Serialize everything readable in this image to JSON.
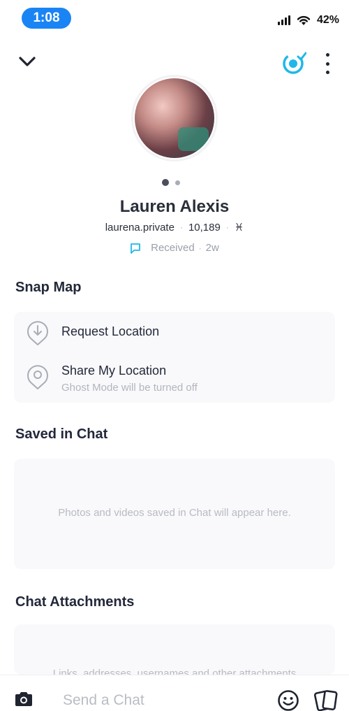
{
  "status_bar": {
    "time": "1:08",
    "battery": "42%"
  },
  "profile": {
    "name": "Lauren Alexis",
    "username": "laurena.private",
    "score": "10,189",
    "zodiac": "♓",
    "chat_status": "Received",
    "chat_age": "2w"
  },
  "snap_map": {
    "title": "Snap Map",
    "request_location": "Request Location",
    "share_location": "Share My Location",
    "share_location_sub": "Ghost Mode will be turned off"
  },
  "saved_in_chat": {
    "title": "Saved in Chat",
    "empty_text": "Photos and videos saved in Chat will appear here."
  },
  "chat_attachments": {
    "title": "Chat Attachments",
    "empty_text": "Links, addresses, usernames and other attachments"
  },
  "chat_bar": {
    "placeholder": "Send a Chat"
  },
  "icons": {
    "back": "chevron-down-icon",
    "friend_action": "friend-check-icon",
    "more": "more-vertical-icon",
    "camera": "camera-icon",
    "emoji": "emoji-icon",
    "sticker": "sticker-icon"
  },
  "colors": {
    "accent_blue": "#1a84f5",
    "snap_cyan": "#1fb8e8"
  }
}
